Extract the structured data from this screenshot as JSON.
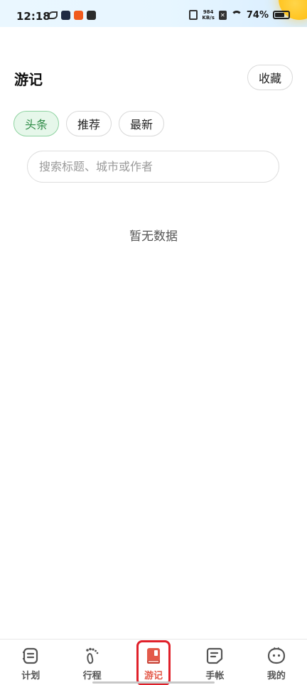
{
  "status_bar": {
    "time": "12:18",
    "net_speed_value": "984",
    "net_speed_unit": "KB/s",
    "battery_percent": "74%",
    "battery_level": 0.74
  },
  "header": {
    "title": "游记",
    "favorites_label": "收藏"
  },
  "tabs": [
    {
      "label": "头条",
      "active": true
    },
    {
      "label": "推荐",
      "active": false
    },
    {
      "label": "最新",
      "active": false
    }
  ],
  "search": {
    "placeholder": "搜索标题、城市或作者",
    "value": ""
  },
  "empty_state": {
    "text": "暂无数据"
  },
  "bottom_nav": {
    "items": [
      {
        "label": "计划",
        "icon": "plan-icon",
        "active": false
      },
      {
        "label": "行程",
        "icon": "footprint-icon",
        "active": false
      },
      {
        "label": "游记",
        "icon": "travel-notes-icon",
        "active": true
      },
      {
        "label": "手帐",
        "icon": "journal-icon",
        "active": false
      },
      {
        "label": "我的",
        "icon": "profile-icon",
        "active": false
      }
    ]
  },
  "colors": {
    "accent_green": "#2e8b46",
    "active_nav_red": "#e35a4a",
    "highlight_red": "#e0202a"
  }
}
